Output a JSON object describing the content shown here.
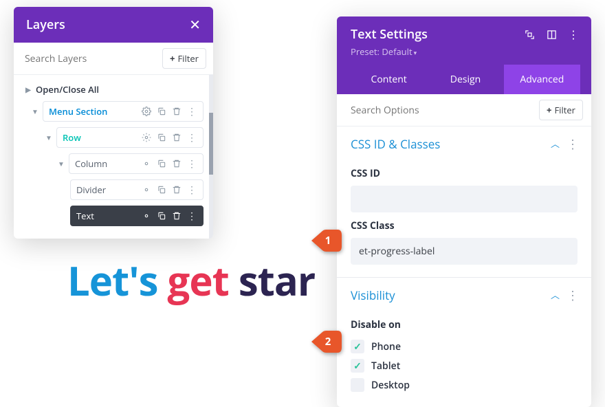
{
  "layers": {
    "title": "Layers",
    "search_placeholder": "Search Layers",
    "filter_label": "Filter",
    "open_close_all": "Open/Close All",
    "items": [
      {
        "label": "Menu Section",
        "style": "blue"
      },
      {
        "label": "Row",
        "style": "teal"
      },
      {
        "label": "Column",
        "style": "gray"
      },
      {
        "label": "Divider",
        "style": "gray"
      },
      {
        "label": "Text",
        "style": "dark"
      }
    ]
  },
  "hero": {
    "w1": "Let's ",
    "w2": "get ",
    "w3": "star"
  },
  "settings": {
    "title": "Text Settings",
    "preset": "Preset: Default",
    "filter_label": "Filter",
    "tabs": [
      "Content",
      "Design",
      "Advanced"
    ],
    "active_tab": 2,
    "search_placeholder": "Search Options",
    "css_section": {
      "title": "CSS ID & Classes",
      "id_label": "CSS ID",
      "id_value": "",
      "class_label": "CSS Class",
      "class_value": "et-progress-label"
    },
    "visibility_section": {
      "title": "Visibility",
      "disable_label": "Disable on",
      "options": [
        {
          "label": "Phone",
          "checked": true
        },
        {
          "label": "Tablet",
          "checked": true
        },
        {
          "label": "Desktop",
          "checked": false
        }
      ]
    }
  },
  "callouts": {
    "c1": "1",
    "c2": "2"
  }
}
